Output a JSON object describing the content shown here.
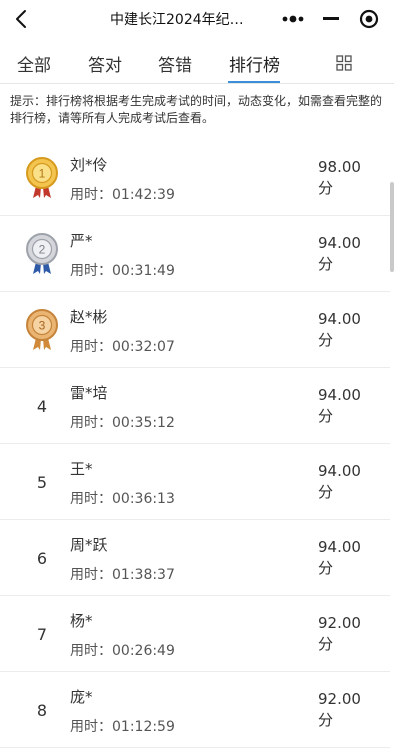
{
  "header": {
    "title": "中建长江2024年纪…"
  },
  "tabs": [
    {
      "label": "全部"
    },
    {
      "label": "答对"
    },
    {
      "label": "答错"
    },
    {
      "label": "排行榜"
    }
  ],
  "notice": "提示：排行榜将根据考生完成考试的时间，动态变化，如需查看完整的排行榜，请等所有人完成考试后查看。",
  "ranking": [
    {
      "rank": "1",
      "name": "刘*伶",
      "time": "用时：01:42:39",
      "score": "98.00",
      "unit": "分"
    },
    {
      "rank": "2",
      "name": "严*",
      "time": "用时：00:31:49",
      "score": "94.00",
      "unit": "分"
    },
    {
      "rank": "3",
      "name": "赵*彬",
      "time": "用时：00:32:07",
      "score": "94.00",
      "unit": "分"
    },
    {
      "rank": "4",
      "name": "雷*培",
      "time": "用时：00:35:12",
      "score": "94.00",
      "unit": "分"
    },
    {
      "rank": "5",
      "name": "王*",
      "time": "用时：00:36:13",
      "score": "94.00",
      "unit": "分"
    },
    {
      "rank": "6",
      "name": "周*跃",
      "time": "用时：01:38:37",
      "score": "94.00",
      "unit": "分"
    },
    {
      "rank": "7",
      "name": "杨*",
      "time": "用时：00:26:49",
      "score": "92.00",
      "unit": "分"
    },
    {
      "rank": "8",
      "name": "庞*",
      "time": "用时：01:12:59",
      "score": "92.00",
      "unit": "分"
    }
  ],
  "medals": {
    "gold": "#e8b23a",
    "silver": "#b9bcc4",
    "bronze": "#e0a45a"
  },
  "accent": "#3a8fd8"
}
